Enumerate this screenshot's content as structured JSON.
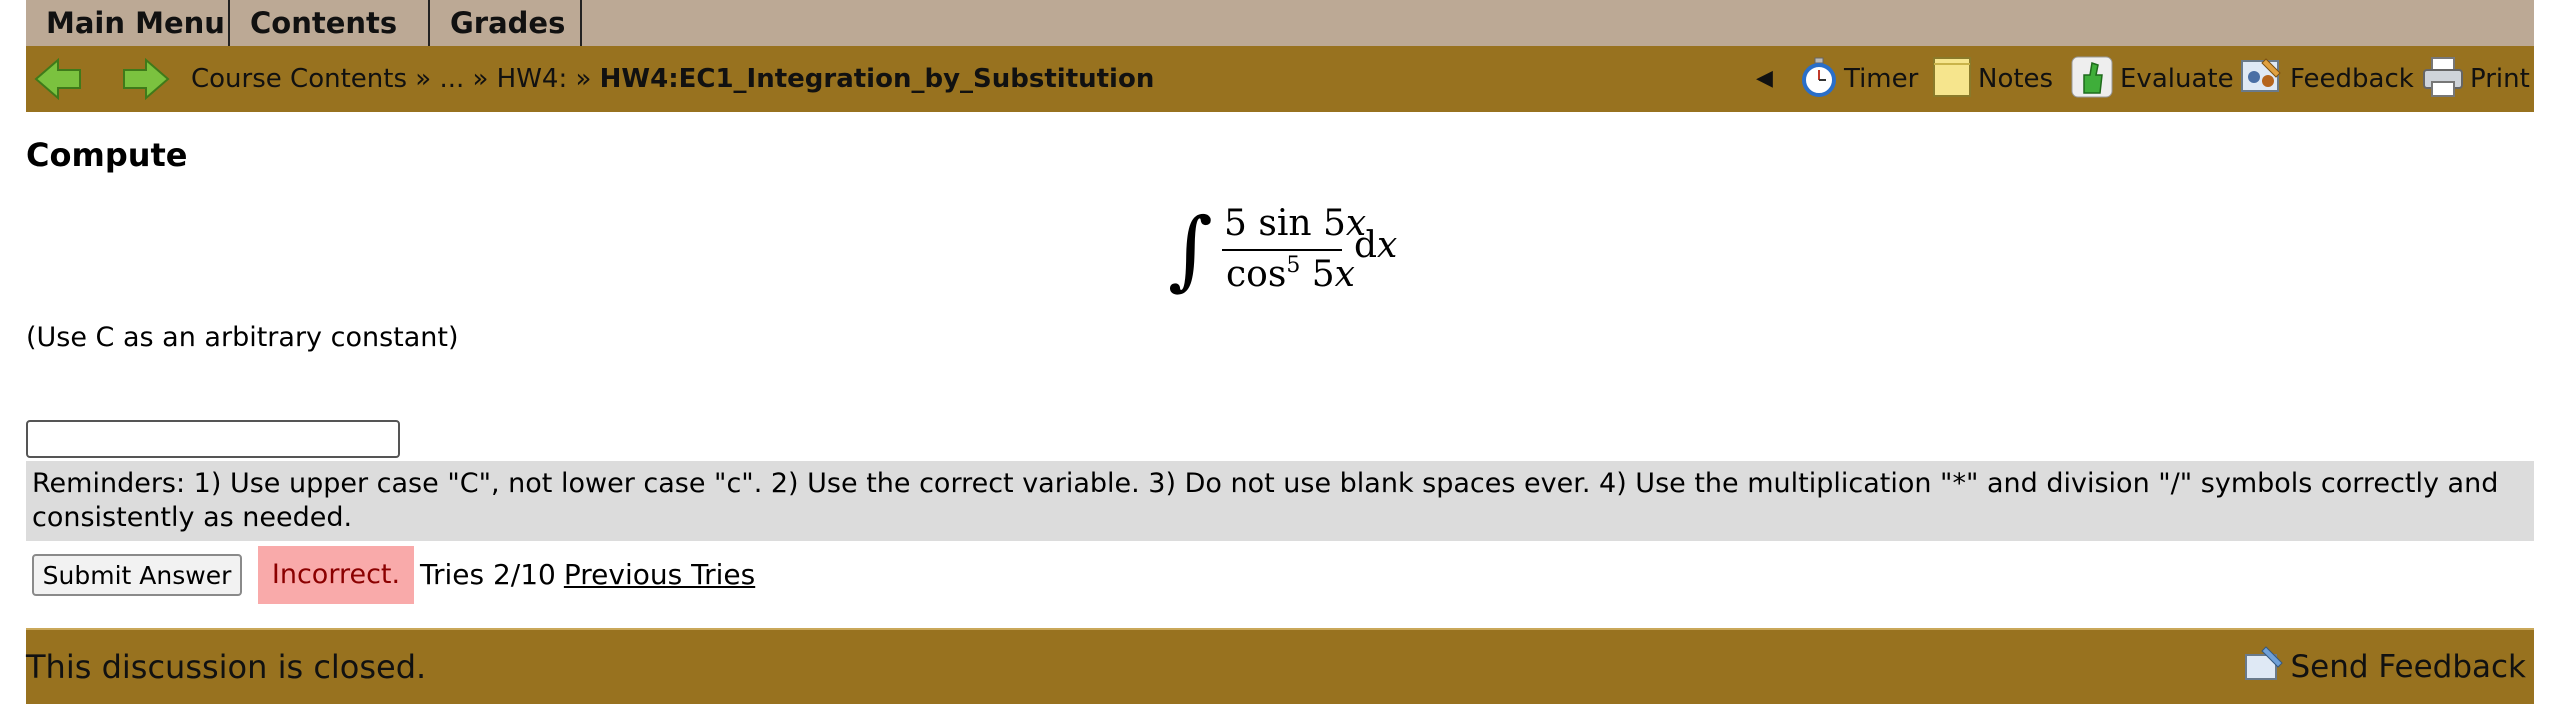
{
  "menu_tabs": [
    "Main Menu",
    "Contents",
    "Grades"
  ],
  "nav": {
    "back_icon": "left-arrow-icon",
    "forward_icon": "right-arrow-icon",
    "breadcrumb": {
      "root": "Course Contents",
      "sep1": " » ",
      "ellipsis": "...",
      "sep2": " » ",
      "folder": "HW4:",
      "sep3": " » ",
      "current": "HW4:EC1_Integration_by_Substitution"
    },
    "collapse_glyph": "◀",
    "tools": {
      "timer": "Timer",
      "notes": "Notes",
      "evaluate": "Evaluate",
      "feedback": "Feedback",
      "print": "Print"
    }
  },
  "problem": {
    "heading": "Compute",
    "formula": {
      "numerator": "5 sin 5",
      "numerator_var": "x",
      "denominator_fn": "cos",
      "denominator_exp": "5",
      "denominator_arg": " 5",
      "denominator_var": "x",
      "differential": "d",
      "differential_var": "x"
    },
    "hint": "(Use C as an arbitrary constant)",
    "answer_value": "",
    "reminders": "Reminders: 1) Use upper case \"C\", not lower case \"c\". 2) Use the correct variable. 3) Do not use blank spaces ever. 4) Use the multiplication \"*\" and division \"/\" symbols correctly and consistently as needed."
  },
  "submission": {
    "submit_label": "Submit Answer",
    "status": "Incorrect.",
    "tries": "Tries 2/10",
    "previous_tries": "Previous Tries"
  },
  "footer": {
    "closed_text": "This discussion is closed.",
    "send_feedback": "Send Feedback"
  },
  "colors": {
    "tab_bar": "#bca995",
    "nav_bar": "#98721f",
    "reminder_bg": "#dcdcdc",
    "incorrect_bg": "#f9aaaa",
    "incorrect_text": "#8b0000"
  }
}
